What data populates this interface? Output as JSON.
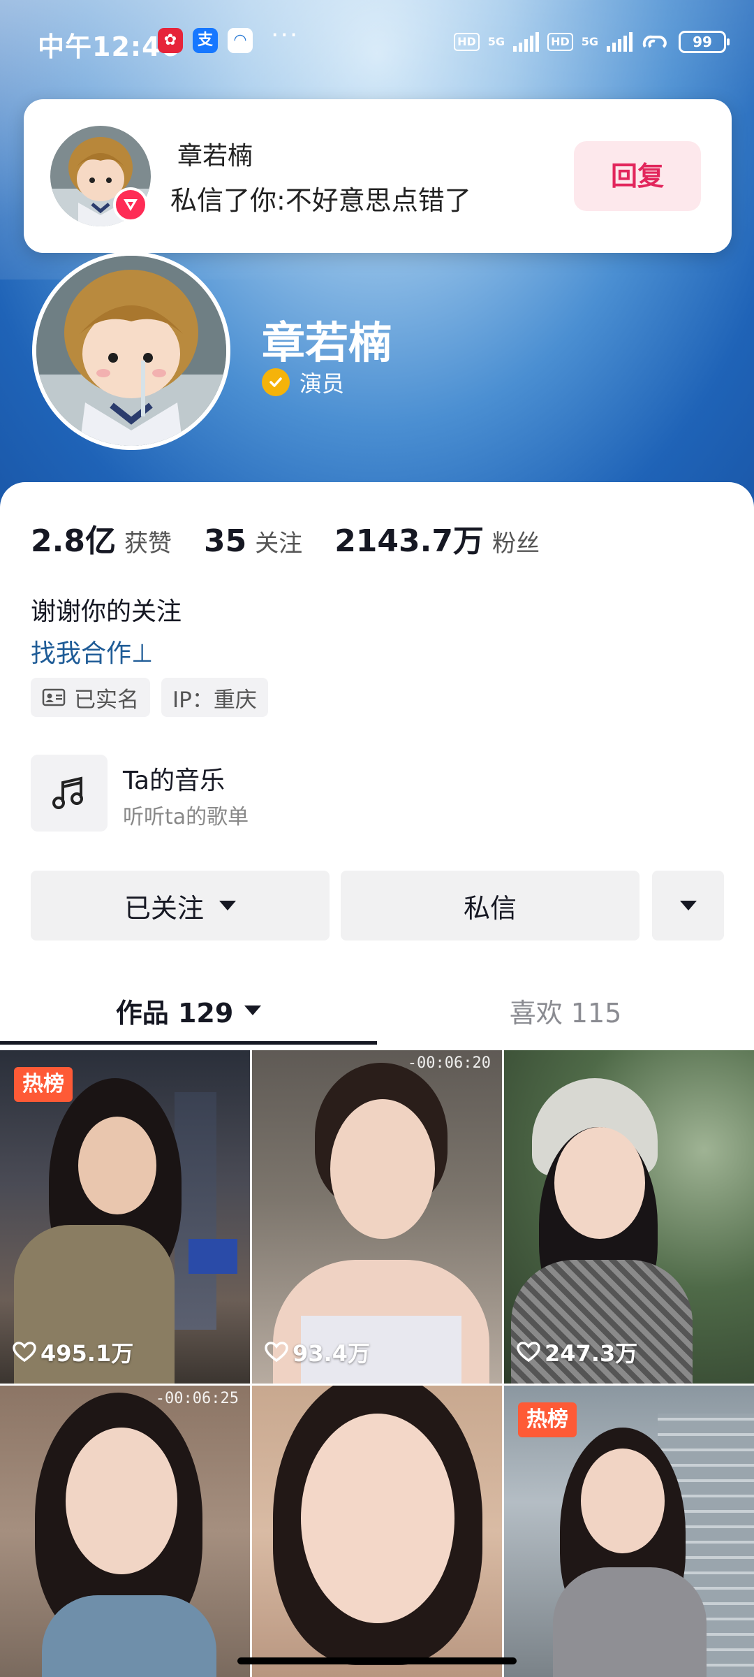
{
  "status_bar": {
    "time": "中午12:46",
    "app_icons": [
      {
        "name": "red-app-icon",
        "glyph": "✿",
        "color": "#e6243a"
      },
      {
        "name": "alipay-icon",
        "glyph": "支",
        "color": "#1677ff"
      },
      {
        "name": "cloud-app-icon",
        "glyph": "◠",
        "color": "#2a7ad5"
      }
    ],
    "more": "···",
    "hd1": "HD",
    "net1": "5G",
    "hd2": "HD",
    "net2": "5G",
    "battery": "99"
  },
  "notification": {
    "sender": "章若楠",
    "message": "私信了你:不好意思点错了",
    "reply_label": "回复",
    "badge_color": "#fe2c55"
  },
  "profile": {
    "name": "章若楠",
    "verification": "演员",
    "stats": [
      {
        "value": "2.8亿",
        "label": "获赞"
      },
      {
        "value": "35",
        "label": "关注"
      },
      {
        "value": "2143.7万",
        "label": "粉丝"
      }
    ],
    "bio": "谢谢你的关注",
    "bio_link": "找我合作⊥",
    "tags": [
      {
        "icon": "id-card-icon",
        "label": "已实名"
      },
      {
        "icon": "",
        "label": "IP：重庆"
      }
    ]
  },
  "music": {
    "title": "Ta的音乐",
    "subtitle": "听听ta的歌单"
  },
  "actions": {
    "follow_label": "已关注",
    "message_label": "私信"
  },
  "tabs": [
    {
      "label": "作品 129",
      "active": true
    },
    {
      "label": "喜欢 115",
      "active": false
    }
  ],
  "videos": [
    {
      "likes": "495.1万",
      "badge": "热榜",
      "duration": ""
    },
    {
      "likes": "93.4万",
      "badge": "",
      "duration": "-00:06:20"
    },
    {
      "likes": "247.3万",
      "badge": "",
      "duration": ""
    },
    {
      "likes": "",
      "badge": "",
      "duration": "-00:06:25"
    },
    {
      "likes": "",
      "badge": "",
      "duration": ""
    },
    {
      "likes": "",
      "badge": "热榜",
      "duration": ""
    }
  ],
  "colors": {
    "accent": "#fe2c55",
    "link": "#1f5c97",
    "verified": "#f5b30a",
    "hot_badge": "#fe5a36"
  }
}
